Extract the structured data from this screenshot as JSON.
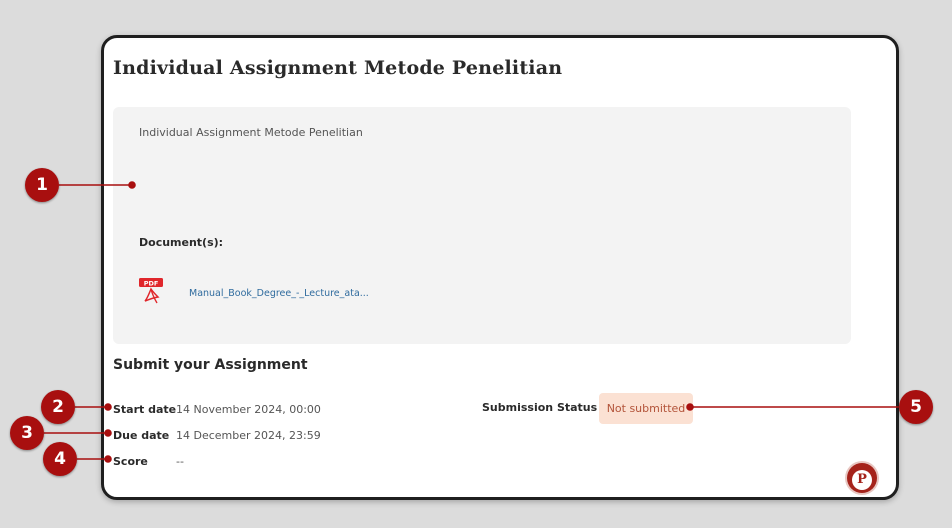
{
  "assignment": {
    "title": "Individual Assignment Metode Penelitian",
    "description": "Individual Assignment Metode Penelitian",
    "documents_label": "Document(s):",
    "document_file": "Manual_Book_Degree_-_Lecture_ata...",
    "pdf_badge": "PDF"
  },
  "submission": {
    "section_title": "Submit your Assignment",
    "start_date_label": "Start date",
    "start_date_value": "14 November 2024, 00:00",
    "due_date_label": "Due date",
    "due_date_value": "14 December 2024, 23:59",
    "score_label": "Score",
    "score_value": "--",
    "status_label": "Submission Status",
    "status_value": "Not submitted"
  },
  "fab": {
    "letter": "P"
  },
  "annotations": [
    "1",
    "2",
    "3",
    "4",
    "5"
  ],
  "colors": {
    "marker": "#a80f0f",
    "badge_bg": "#fbe1d3",
    "badge_text": "#b3543a",
    "link": "#2f6b9e"
  }
}
